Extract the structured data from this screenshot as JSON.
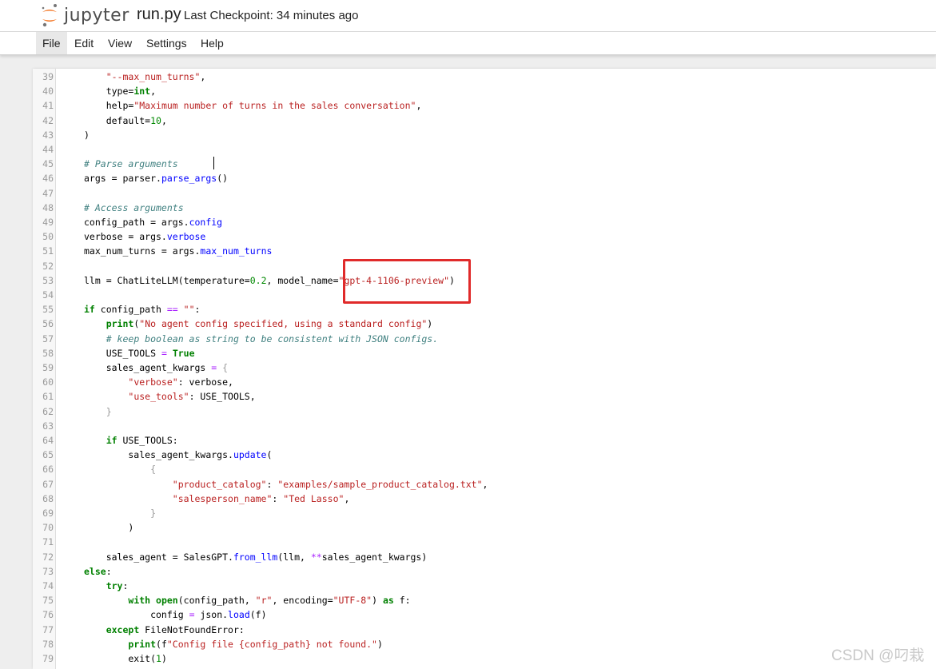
{
  "header": {
    "logo_text": "jupyter",
    "notebook_name": "run.py",
    "checkpoint": "Last Checkpoint: 34 minutes ago"
  },
  "menu": [
    {
      "label": "File"
    },
    {
      "label": "Edit"
    },
    {
      "label": "View"
    },
    {
      "label": "Settings"
    },
    {
      "label": "Help"
    }
  ],
  "editor": {
    "lines": [
      {
        "n": "39",
        "t": [
          [
            "str",
            "\"--max_num_turns\""
          ],
          [
            "p",
            ","
          ]
        ]
      },
      {
        "n": "40",
        "t": [
          [
            "p",
            "type="
          ],
          [
            "kw",
            "int"
          ],
          [
            "p",
            ","
          ]
        ]
      },
      {
        "n": "41",
        "t": [
          [
            "p",
            "help="
          ],
          [
            "str",
            "\"Maximum number of turns in the sales conversation\""
          ],
          [
            "p",
            ","
          ]
        ]
      },
      {
        "n": "42",
        "t": [
          [
            "p",
            "default="
          ],
          [
            "num",
            "10"
          ],
          [
            "p",
            ","
          ]
        ]
      },
      {
        "n": "43",
        "t": [
          [
            "p",
            ")"
          ]
        ]
      },
      {
        "n": "44",
        "t": []
      },
      {
        "n": "45",
        "t": [
          [
            "cmt",
            "# Parse arguments"
          ]
        ]
      },
      {
        "n": "46",
        "t": [
          [
            "p",
            "args = parser."
          ],
          [
            "attr",
            "parse_args"
          ],
          [
            "p",
            "()"
          ]
        ]
      },
      {
        "n": "47",
        "t": []
      },
      {
        "n": "48",
        "t": [
          [
            "cmt",
            "# Access arguments"
          ]
        ]
      },
      {
        "n": "49",
        "t": [
          [
            "p",
            "config_path = args."
          ],
          [
            "attr",
            "config"
          ]
        ]
      },
      {
        "n": "50",
        "t": [
          [
            "p",
            "verbose = args."
          ],
          [
            "attr",
            "verbose"
          ]
        ]
      },
      {
        "n": "51",
        "t": [
          [
            "p",
            "max_num_turns = args."
          ],
          [
            "attr",
            "max_num_turns"
          ]
        ]
      },
      {
        "n": "52",
        "t": []
      },
      {
        "n": "53",
        "t": [
          [
            "p",
            "llm = ChatLiteLLM(temperature="
          ],
          [
            "num",
            "0.2"
          ],
          [
            "p",
            ", model_name="
          ],
          [
            "str",
            "\"gpt-4-1106-preview\""
          ],
          [
            "p",
            ")"
          ]
        ]
      },
      {
        "n": "54",
        "t": []
      },
      {
        "n": "55",
        "t": [
          [
            "kw",
            "if"
          ],
          [
            "p",
            " config_path "
          ],
          [
            "op",
            "=="
          ],
          [
            "p",
            " "
          ],
          [
            "str",
            "\"\""
          ],
          [
            "p",
            ":"
          ]
        ]
      },
      {
        "n": "56",
        "t": [
          [
            "p",
            "    "
          ],
          [
            "kw",
            "print"
          ],
          [
            "p",
            "("
          ],
          [
            "str",
            "\"No agent config specified, using a standard config\""
          ],
          [
            "p",
            ")"
          ]
        ]
      },
      {
        "n": "57",
        "t": [
          [
            "p",
            "    "
          ],
          [
            "cmt",
            "# keep boolean as string to be consistent with JSON configs."
          ]
        ]
      },
      {
        "n": "58",
        "t": [
          [
            "p",
            "    USE_TOOLS "
          ],
          [
            "op",
            "="
          ],
          [
            "p",
            " "
          ],
          [
            "kw",
            "True"
          ]
        ]
      },
      {
        "n": "59",
        "t": [
          [
            "p",
            "    sales_agent_kwargs "
          ],
          [
            "op",
            "="
          ],
          [
            "p",
            " "
          ],
          [
            "brace",
            "{"
          ]
        ]
      },
      {
        "n": "60",
        "t": [
          [
            "p",
            "        "
          ],
          [
            "str",
            "\"verbose\""
          ],
          [
            "p",
            ": verbose,"
          ]
        ]
      },
      {
        "n": "61",
        "t": [
          [
            "p",
            "        "
          ],
          [
            "str",
            "\"use_tools\""
          ],
          [
            "p",
            ": USE_TOOLS,"
          ]
        ]
      },
      {
        "n": "62",
        "t": [
          [
            "p",
            "    "
          ],
          [
            "brace",
            "}"
          ]
        ]
      },
      {
        "n": "63",
        "t": []
      },
      {
        "n": "64",
        "t": [
          [
            "p",
            "    "
          ],
          [
            "kw",
            "if"
          ],
          [
            "p",
            " USE_TOOLS:"
          ]
        ]
      },
      {
        "n": "65",
        "t": [
          [
            "p",
            "        sales_agent_kwargs."
          ],
          [
            "attr",
            "update"
          ],
          [
            "p",
            "("
          ]
        ]
      },
      {
        "n": "66",
        "t": [
          [
            "p",
            "            "
          ],
          [
            "brace",
            "{"
          ]
        ]
      },
      {
        "n": "67",
        "t": [
          [
            "p",
            "                "
          ],
          [
            "str",
            "\"product_catalog\""
          ],
          [
            "p",
            ": "
          ],
          [
            "str",
            "\"examples/sample_product_catalog.txt\""
          ],
          [
            "p",
            ","
          ]
        ]
      },
      {
        "n": "68",
        "t": [
          [
            "p",
            "                "
          ],
          [
            "str",
            "\"salesperson_name\""
          ],
          [
            "p",
            ": "
          ],
          [
            "str",
            "\"Ted Lasso\""
          ],
          [
            "p",
            ","
          ]
        ]
      },
      {
        "n": "69",
        "t": [
          [
            "p",
            "            "
          ],
          [
            "brace",
            "}"
          ]
        ]
      },
      {
        "n": "70",
        "t": [
          [
            "p",
            "        )"
          ]
        ]
      },
      {
        "n": "71",
        "t": []
      },
      {
        "n": "72",
        "t": [
          [
            "p",
            "    sales_agent = SalesGPT."
          ],
          [
            "attr",
            "from_llm"
          ],
          [
            "p",
            "(llm, "
          ],
          [
            "op",
            "**"
          ],
          [
            "p",
            "sales_agent_kwargs)"
          ]
        ]
      },
      {
        "n": "73",
        "t": [
          [
            "kw",
            "else"
          ],
          [
            "p",
            ":"
          ]
        ]
      },
      {
        "n": "74",
        "t": [
          [
            "p",
            "    "
          ],
          [
            "kw",
            "try"
          ],
          [
            "p",
            ":"
          ]
        ]
      },
      {
        "n": "75",
        "t": [
          [
            "p",
            "        "
          ],
          [
            "kw",
            "with"
          ],
          [
            "p",
            " "
          ],
          [
            "kw",
            "open"
          ],
          [
            "p",
            "(config_path, "
          ],
          [
            "str",
            "\"r\""
          ],
          [
            "p",
            ", encoding="
          ],
          [
            "str",
            "\"UTF-8\""
          ],
          [
            "p",
            ") "
          ],
          [
            "kw",
            "as"
          ],
          [
            "p",
            " f:"
          ]
        ]
      },
      {
        "n": "76",
        "t": [
          [
            "p",
            "            config "
          ],
          [
            "op",
            "="
          ],
          [
            "p",
            " json."
          ],
          [
            "attr",
            "load"
          ],
          [
            "p",
            "(f)"
          ]
        ]
      },
      {
        "n": "77",
        "t": [
          [
            "p",
            "    "
          ],
          [
            "kw",
            "except"
          ],
          [
            "p",
            " FileNotFoundError:"
          ]
        ]
      },
      {
        "n": "78",
        "t": [
          [
            "p",
            "        "
          ],
          [
            "kw",
            "print"
          ],
          [
            "p",
            "(f"
          ],
          [
            "str",
            "\"Config file {config_path} not found.\""
          ],
          [
            "p",
            ")"
          ]
        ]
      },
      {
        "n": "79",
        "t": [
          [
            "p",
            "        exit("
          ],
          [
            "num",
            "1"
          ],
          [
            "p",
            ")"
          ]
        ]
      }
    ]
  },
  "watermark": "CSDN @叼栽",
  "colors": {
    "highlight_box": "#e02a2a",
    "logo_orange": "#f37726"
  }
}
